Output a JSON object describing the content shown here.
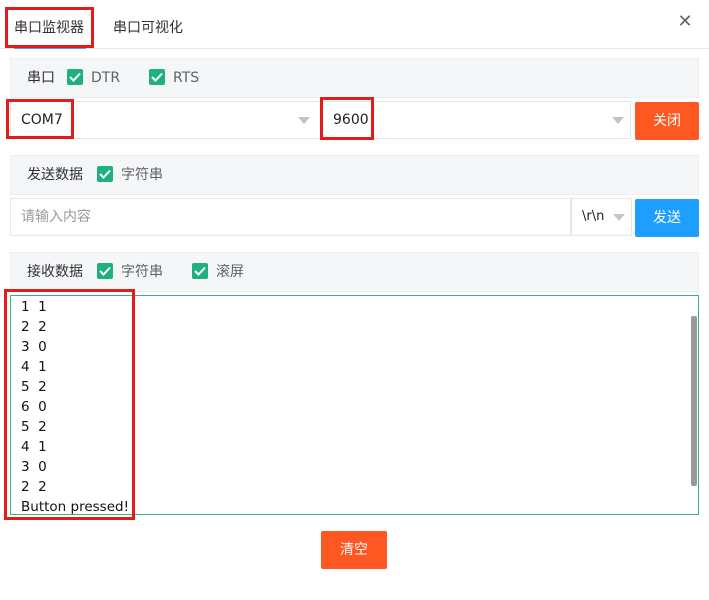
{
  "tabs": [
    {
      "label": "串口监视器",
      "active": true
    },
    {
      "label": "串口可视化",
      "active": false
    }
  ],
  "close_icon": "close-icon",
  "serial": {
    "title": "串口",
    "dtr_label": "DTR",
    "rts_label": "RTS",
    "dtr_checked": true,
    "rts_checked": true,
    "port": "COM7",
    "baud": "9600",
    "close_button": "关闭"
  },
  "send": {
    "title": "发送数据",
    "string_label": "字符串",
    "string_checked": true,
    "placeholder": "请输入内容",
    "line_ending": "\\r\\n",
    "send_button": "发送"
  },
  "receive": {
    "title": "接收数据",
    "string_label": "字符串",
    "scroll_label": "滚屏",
    "string_checked": true,
    "scroll_checked": true,
    "lines": [
      "1  1",
      "2  2",
      "3  0",
      "4  1",
      "5  2",
      "6  0",
      "5  2",
      "4  1",
      "3  0",
      "2  2",
      "Button pressed!"
    ]
  },
  "clear_button": "清空",
  "colors": {
    "accent_orange": "#ff5722",
    "accent_blue": "#1e9fff",
    "checkbox_green": "#1eb07f",
    "highlight_red": "#e21b1b"
  }
}
